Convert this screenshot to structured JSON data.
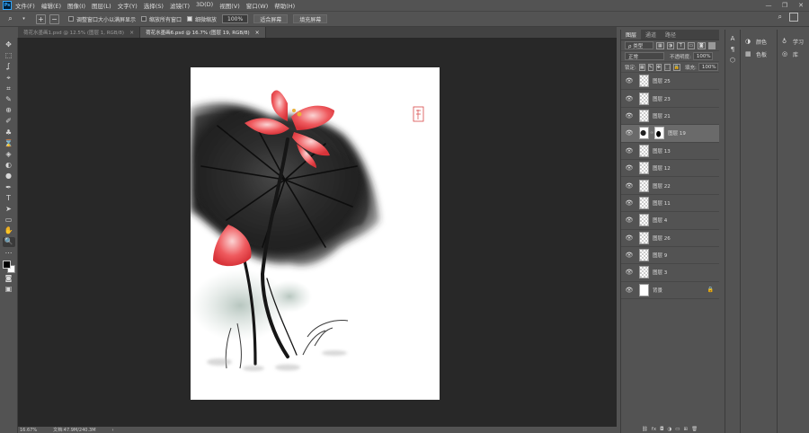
{
  "app": {
    "logo": "Ps",
    "accent": "#31a8ff"
  },
  "menu": [
    "文件(F)",
    "编辑(E)",
    "图像(I)",
    "图层(L)",
    "文字(Y)",
    "选择(S)",
    "滤镜(T)",
    "3D(D)",
    "视图(V)",
    "窗口(W)",
    "帮助(H)"
  ],
  "window_controls": {
    "minimize": "—",
    "maximize": "❐",
    "close": "✕"
  },
  "options": {
    "tool_icon": "magnify-icon",
    "resize_windows_label": "调整窗口大小以满屏显示",
    "zoom_all_label": "缩放所有窗口",
    "scrubby_zoom_label": "细微缩放",
    "zoom_value": "100%",
    "fit_screen_label": "适合屏幕",
    "fill_screen_label": "填充屏幕"
  },
  "tabs": [
    {
      "label": "荷花水墨画1.psd @ 12.5% (图层 1, RGB/8)",
      "close": "×"
    },
    {
      "label": "荷花水墨画6.psd @ 16.7% (图层 19, RGB/8)",
      "close": "×"
    }
  ],
  "tools": [
    "✥",
    "⬚",
    "ʆ",
    "⌖",
    "⌗",
    "✎",
    "⊕",
    "✐",
    "♣",
    "⌛",
    "◈",
    "◐",
    "●",
    "✒",
    "T",
    "➤",
    "▭",
    "✋",
    "🔍",
    "⋯"
  ],
  "status": {
    "zoom": "16.67%",
    "doc": "文档:47.9M/240.3M",
    "arrow": "›"
  },
  "layers_panel": {
    "tabs": [
      "图层",
      "通道",
      "路径"
    ],
    "filter_kind": "ρ 类型",
    "blend_mode": "正常",
    "opacity_label": "不透明度:",
    "opacity_value": "100%",
    "lock_label": "锁定:",
    "fill_label": "填充:",
    "fill_value": "100%",
    "layers": [
      {
        "name": "图层 25",
        "thumb": "transparent"
      },
      {
        "name": "图层 23",
        "thumb": "transparent"
      },
      {
        "name": "图层 21",
        "thumb": "transparent"
      },
      {
        "name": "图层 19",
        "thumb": "ink",
        "mask": true,
        "selected": true
      },
      {
        "name": "图层 13",
        "thumb": "transparent"
      },
      {
        "name": "图层 12",
        "thumb": "transparent"
      },
      {
        "name": "图层 22",
        "thumb": "transparent"
      },
      {
        "name": "图层 11",
        "thumb": "transparent"
      },
      {
        "name": "图层 4",
        "thumb": "transparent"
      },
      {
        "name": "图层 26",
        "thumb": "transparent"
      },
      {
        "name": "图层 9",
        "thumb": "transparent"
      },
      {
        "name": "图层 3",
        "thumb": "transparent"
      },
      {
        "name": "背景",
        "thumb": "white",
        "locked": true
      }
    ],
    "footer": [
      "⛓",
      "fx",
      "◘",
      "◑",
      "▭",
      "⊞",
      "🗑"
    ]
  },
  "right_panels": {
    "color_label": "颜色",
    "swatches_label": "色板",
    "learn_label": "学习",
    "library_label": "库"
  }
}
